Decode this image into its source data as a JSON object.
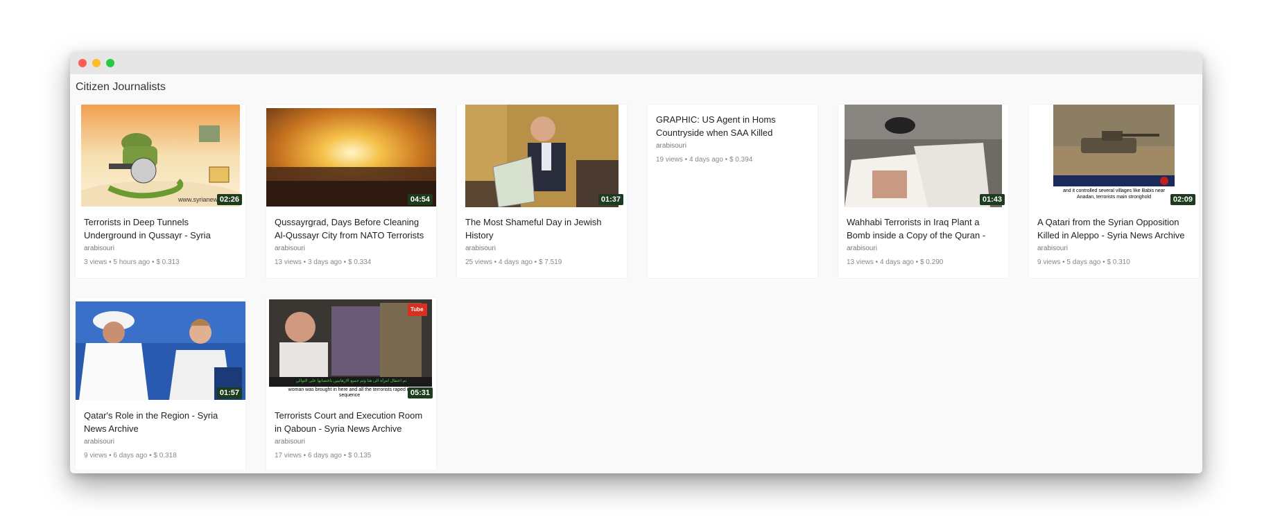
{
  "window": {
    "traffic_lights": [
      "close",
      "minimize",
      "zoom"
    ]
  },
  "section_title": "Citizen Journalists",
  "videos": [
    {
      "title": "Terrorists in Deep Tunnels Underground in Qussayr - Syria",
      "author": "arabisouri",
      "views": "3 views",
      "age": "5 hours ago",
      "price": "$ 0.313",
      "duration": "02:26",
      "thumb_desc": "cartoon-soldier-thumbnail"
    },
    {
      "title": "Qussayrgrad, Days Before Cleaning Al-Qussayr City from NATO Terrorists",
      "author": "arabisouri",
      "views": "13 views",
      "age": "3 days ago",
      "price": "$ 0.334",
      "duration": "04:54",
      "thumb_desc": "city-sunset-thumbnail"
    },
    {
      "title": "The Most Shameful Day in Jewish History",
      "author": "arabisouri",
      "views": "25 views",
      "age": "4 days ago",
      "price": "$ 7.519",
      "duration": "01:37",
      "thumb_desc": "man-reading-book-thumbnail"
    },
    {
      "title": "GRAPHIC: US Agent in Homs Countryside when SAA Killed",
      "author": "arabisouri",
      "views": "19 views",
      "age": "4 days ago",
      "price": "$ 0.394",
      "duration": "",
      "thumb_desc": ""
    },
    {
      "title": "Wahhabi Terrorists in Iraq Plant a Bomb inside a Copy of the Quran -",
      "author": "arabisouri",
      "views": "13 views",
      "age": "4 days ago",
      "price": "$ 0.290",
      "duration": "01:43",
      "thumb_desc": "book-bomb-thumbnail"
    },
    {
      "title": "A Qatari from the Syrian Opposition Killed in Aleppo - Syria News Archive",
      "author": "arabisouri",
      "views": "9 views",
      "age": "5 days ago",
      "price": "$ 0.310",
      "duration": "02:09",
      "thumb_desc": "tank-news-thumbnail"
    },
    {
      "title": "Qatar's Role in the Region - Syria News Archive",
      "author": "arabisouri",
      "views": "9 views",
      "age": "6 days ago",
      "price": "$ 0.318",
      "duration": "01:57",
      "thumb_desc": "two-politicians-thumbnail"
    },
    {
      "title": "Terrorists Court and Execution Room in Qaboun - Syria News Archive",
      "author": "arabisouri",
      "views": "17 views",
      "age": "6 days ago",
      "price": "$ 0.135",
      "duration": "05:31",
      "thumb_desc": "man-in-room-thumbnail"
    }
  ],
  "thumb_overlays": {
    "v2_arabic": "تم اعتقال امرأة الى هنا وتم جميع الارهابيين باغتصابها على التوالي",
    "v2_caption": "woman was brought in here and all the terrorists raped in sequence",
    "v2_logo": "Tube",
    "v6_caption": "and it controlled several villages like Babis near Anadan, terrorists main stronghold"
  }
}
